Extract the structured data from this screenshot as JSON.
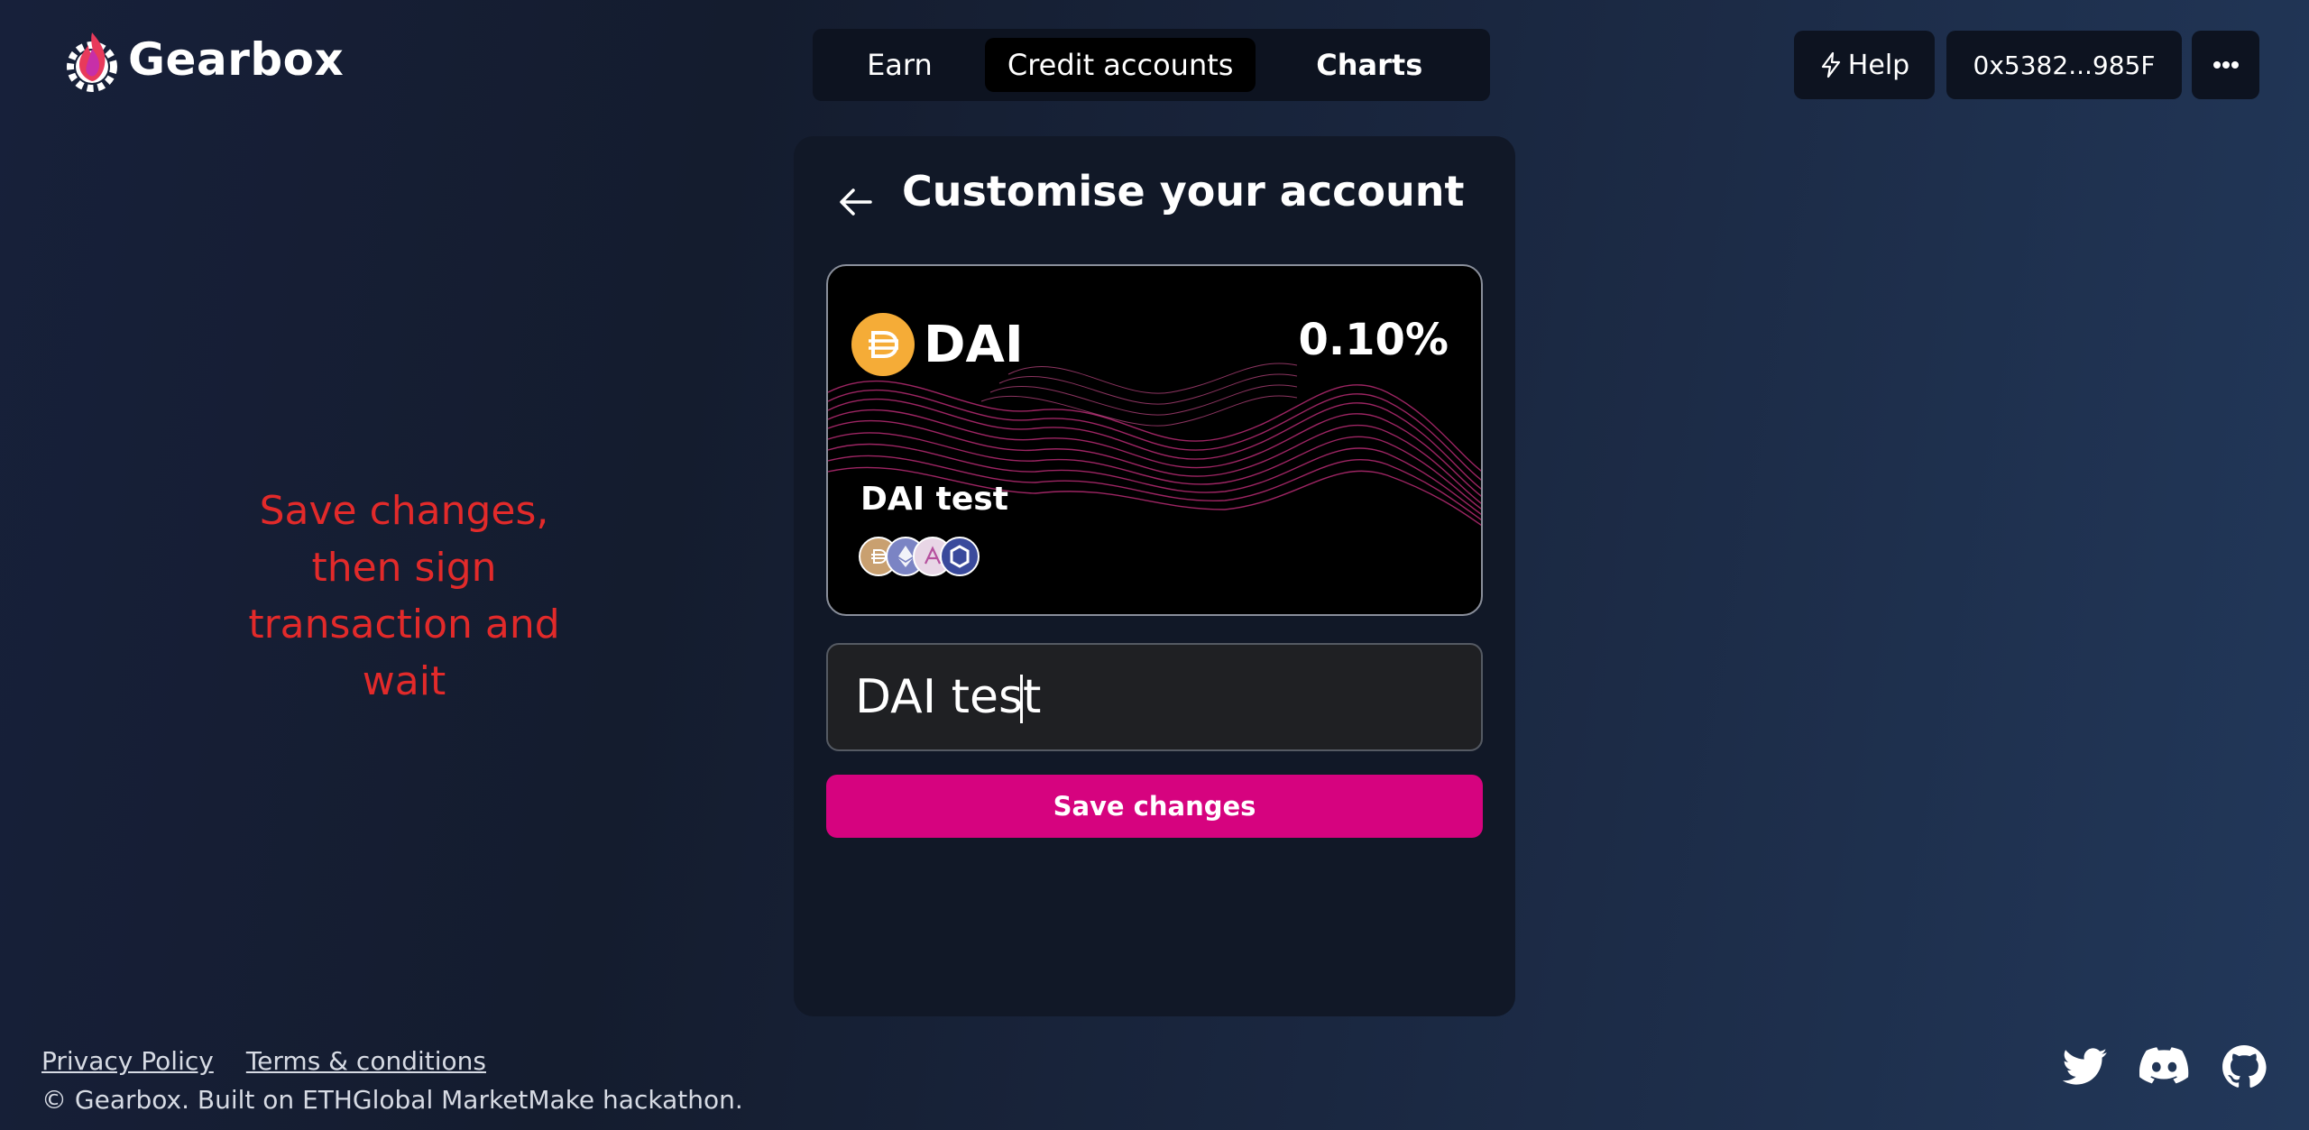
{
  "app": {
    "name": "Gearbox"
  },
  "nav": {
    "items": [
      {
        "label": "Earn"
      },
      {
        "label": "Credit accounts"
      },
      {
        "label": "Charts"
      }
    ]
  },
  "header": {
    "help_label": "Help",
    "wallet_address": "0x5382...985F",
    "more_icon": "more-horizontal-icon"
  },
  "note": {
    "text": "Save changes, then sign transaction and wait"
  },
  "panel": {
    "title": "Customise your account",
    "card": {
      "token": "DAI",
      "rate": "0.10%",
      "account_name": "DAI test",
      "assets": [
        "dai-icon",
        "ethereum-icon",
        "aave-icon",
        "chainlink-icon"
      ]
    },
    "name_input": {
      "value": "DAI test"
    },
    "save_label": "Save changes"
  },
  "footer": {
    "privacy": "Privacy Policy",
    "terms": "Terms & conditions",
    "copyright": "© Gearbox. Built on ETHGlobal MarketMake hackathon."
  },
  "colors": {
    "accent": "#d6037f",
    "dai": "#f5ac37",
    "note": "#e22a2a"
  }
}
